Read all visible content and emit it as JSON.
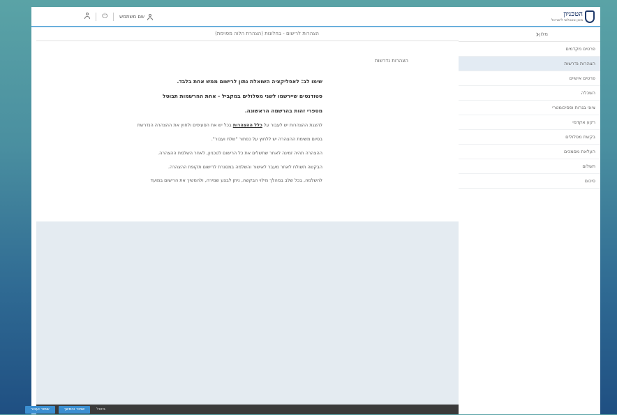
{
  "header": {
    "logo_title": "הטכניון",
    "logo_subtitle": "מכון טכנולוגי לישראל",
    "user_name": "שם משתמש",
    "icons": [
      "person-icon",
      "power-icon",
      "user-icon"
    ]
  },
  "breadcrumb": "הצהרות לרישום - בחלונות (הצהרת הלוה מסוימת)",
  "content": {
    "section_label": "הצהרות נדרשות",
    "paragraphs": [
      "שימו לב: לאפליקציה השואלת נתון לרישום ממש אחת בלבד.",
      "סטודנטים שיירשמו לשני מסלולים במקביל - אחת ההרשמות תבוטל",
      "מספרי זהות בהרשמה הראשונה.",
      "להצגת ההצהרות יש לעבור על",
      "בסיום משימת ההצהרה יש ללחוץ על כפתור \"שלח ועבור\".",
      "ההצהרה תהיה זמינה לאחר שתשלים את כל הרישום לטכניון, לאחר השלמת ההצהרה.",
      "הבקשה תשולח לאחר מעבר לאישור והשלמה במסגרת לרישום תקופת ההצהרה.",
      "להשלמה, בכל שלב במהלך מילוי הבקשה, ניתן לבצע שמירה, ולהמשיך את הרישום במועד"
    ],
    "link_text": "כלל ההצהרות",
    "para_suffix": "בכל יש את הסעיפים ולחוץ את ההצהרה הנדרשת"
  },
  "sidebar": {
    "header_label": "מלון",
    "items": [
      {
        "label": "פרטים מקדמים",
        "active": false
      },
      {
        "label": "הצהרות נדרשות",
        "active": true
      },
      {
        "label": "פרטים אישיים",
        "active": false
      },
      {
        "label": "השכלה",
        "active": false
      },
      {
        "label": "ציוני בגרות ופסיכומטרי",
        "active": false
      },
      {
        "label": "רקע אקדמי",
        "active": false
      },
      {
        "label": "בקשת מסלולים",
        "active": false
      },
      {
        "label": "העלאת מסמכים",
        "active": false
      },
      {
        "label": "תשלום",
        "active": false
      },
      {
        "label": "סיכום",
        "active": false
      }
    ]
  },
  "actions": {
    "plain_label": "ביטול",
    "save_label": "שמור והמשך",
    "submit_label": "שמור ועבור"
  },
  "colors": {
    "accent": "#3b8fd1",
    "header_border": "#6bb0dc",
    "bottom_bar": "#3a3a3a",
    "active_item": "#e3ebf3"
  }
}
